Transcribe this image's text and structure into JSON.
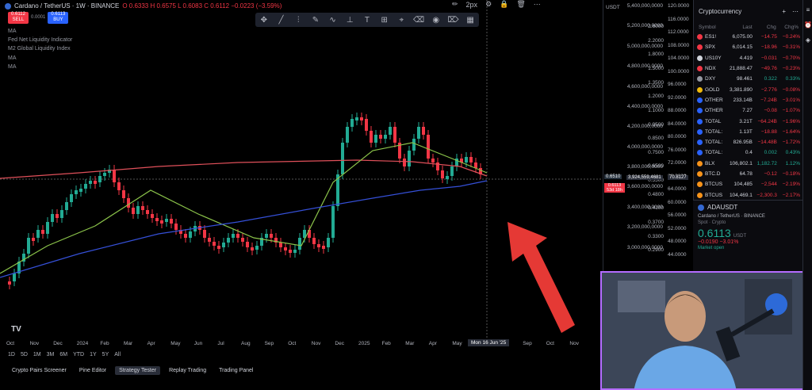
{
  "header": {
    "symbol_title": "Cardano / TetherUS · 1W · BINANCE",
    "ohlc": "O 0.6333  H 0.6575  L 0.6083  C 0.6112  −0.0223 (−3.59%)",
    "sell_price": "0.6112",
    "sell_label": "SELL",
    "spread": "0.0001",
    "buy_price": "0.6113",
    "buy_label": "BUY"
  },
  "indicators": [
    {
      "label": "MA"
    },
    {
      "label": "Fed Net Liquidity Indicator"
    },
    {
      "label": "M2 Global Liquidity Index"
    },
    {
      "label": "MA"
    },
    {
      "label": "MA"
    },
    {
      "label": "MA"
    }
  ],
  "draw_toolbar": {
    "icons": [
      "cross-icon",
      "trend-line-icon",
      "fib-icon",
      "brush-icon",
      "curve-icon",
      "ruler-icon",
      "text-icon",
      "measure-icon",
      "eraser-icon",
      "lock-icon",
      "eye-icon",
      "trash-icon",
      "layout-icon"
    ]
  },
  "top_tools": {
    "width_label": "2px"
  },
  "price_axis_left": {
    "currency": "USDT",
    "labels": [
      "2.6000",
      "2.2000",
      "1.8000",
      "1.5000",
      "1.3500",
      "1.2000",
      "1.1000",
      "0.9500",
      "0.8500",
      "0.7500",
      "0.6500",
      "0.5500",
      "0.4800",
      "0.4100",
      "0.3700",
      "0.3300",
      "0.2900"
    ],
    "current_top": "0.6510",
    "current_a": "0.6113",
    "current_b": "53d 18h"
  },
  "price_axis_mid": {
    "labels": [
      "5,400,000,0000",
      "5,200,000,0000",
      "5,000,000,0000",
      "4,800,000,0000",
      "4,600,000,0000",
      "4,400,000,0000",
      "4,200,000,0000",
      "4,000,000,0000",
      "3,800,000,0000",
      "3,600,000,0000",
      "3,400,000,0000",
      "3,200,000,0000",
      "3,000,000,0000"
    ],
    "highlight": "3,924,559,4681"
  },
  "price_axis_right": {
    "labels": [
      "120.0000",
      "116.0000",
      "112.0000",
      "108.0000",
      "104.0000",
      "100.0000",
      "96.0000",
      "92.0000",
      "88.0000",
      "84.0000",
      "80.0000",
      "76.0000",
      "72.0000",
      "68.0000",
      "64.0000",
      "60.0000",
      "56.0000",
      "52.0000",
      "48.0000",
      "44.0000"
    ],
    "highlight": "70.8127"
  },
  "time_axis": {
    "labels": [
      "Oct",
      "Nov",
      "Dec",
      "2024",
      "Feb",
      "Mar",
      "Apr",
      "May",
      "Jun",
      "Jul",
      "Aug",
      "Sep",
      "Oct",
      "Nov",
      "Dec",
      "2025",
      "Feb",
      "Mar",
      "Apr",
      "May",
      "Jul",
      "Aug",
      "Sep",
      "Oct",
      "Nov"
    ],
    "crosshair_date": "Mon 16 Jun '25"
  },
  "range_bar": [
    "1D",
    "5D",
    "1M",
    "3M",
    "6M",
    "YTD",
    "1Y",
    "5Y",
    "All"
  ],
  "bottom_tabs": [
    {
      "label": "Crypto Pairs Screener",
      "active": false
    },
    {
      "label": "Pine Editor",
      "active": false
    },
    {
      "label": "Strategy Tester",
      "active": true
    },
    {
      "label": "Replay Trading",
      "active": false
    },
    {
      "label": "Trading Panel",
      "active": false
    }
  ],
  "watchlist": {
    "title": "Cryptocurrency",
    "columns": [
      "Symbol",
      "Last",
      "Chg",
      "Chg%"
    ],
    "rows": [
      {
        "symbol": "ES1!",
        "last": "6,075.00",
        "chg": "−14.75",
        "chgp": "−0.24%",
        "dir": "neg",
        "icon": "#f23645"
      },
      {
        "symbol": "SPX",
        "last": "6,014.15",
        "chg": "−18.96",
        "chgp": "−0.31%",
        "dir": "neg",
        "icon": "#f23645"
      },
      {
        "symbol": "US10Y",
        "last": "4.419",
        "chg": "−0.031",
        "chgp": "−0.70%",
        "dir": "neg",
        "icon": "#d1d4dc"
      },
      {
        "symbol": "NDX",
        "last": "21,888.47",
        "chg": "−49.76",
        "chgp": "−0.23%",
        "dir": "neg",
        "icon": "#f23645"
      },
      {
        "symbol": "DXY",
        "last": "98.461",
        "chg": "0.322",
        "chgp": "0.33%",
        "dir": "pos",
        "icon": "#9598a1"
      },
      {
        "symbol": "GOLD",
        "last": "3,381.890",
        "chg": "−2.776",
        "chgp": "−0.08%",
        "dir": "neg",
        "icon": "#f0b90b"
      },
      {
        "symbol": "OTHER",
        "last": "233.14B",
        "chg": "−7.24B",
        "chgp": "−3.01%",
        "dir": "neg",
        "icon": "#2962ff"
      },
      {
        "symbol": "OTHER",
        "last": "7.27",
        "chg": "−0.08",
        "chgp": "−1.07%",
        "dir": "neg",
        "icon": "#2962ff"
      },
      {
        "symbol": "TOTAL",
        "last": "3.21T",
        "chg": "−64.24B",
        "chgp": "−1.96%",
        "dir": "neg",
        "icon": "#2962ff"
      },
      {
        "symbol": "TOTAL:",
        "last": "1.13T",
        "chg": "−18.88",
        "chgp": "−1.64%",
        "dir": "neg",
        "icon": "#2962ff"
      },
      {
        "symbol": "TOTAL:",
        "last": "826.95B",
        "chg": "−14.48B",
        "chgp": "−1.72%",
        "dir": "neg",
        "icon": "#2962ff"
      },
      {
        "symbol": "TOTAL:",
        "last": "0.4",
        "chg": "0.002",
        "chgp": "0.43%",
        "dir": "pos",
        "icon": "#2962ff"
      },
      {
        "symbol": "BLX",
        "last": "106,802.1",
        "chg": "1,182.72",
        "chgp": "1.12%",
        "dir": "pos",
        "icon": "#f7931a"
      },
      {
        "symbol": "BTC.D",
        "last": "64.78",
        "chg": "−0.12",
        "chgp": "−0.18%",
        "dir": "neg",
        "icon": "#f7931a"
      },
      {
        "symbol": "BTCUS",
        "last": "104,485",
        "chg": "−2,544",
        "chgp": "−2.19%",
        "dir": "neg",
        "icon": "#f7931a"
      },
      {
        "symbol": "BTCUS",
        "last": "104,469.1",
        "chg": "−2,300.3",
        "chgp": "−2.17%",
        "dir": "neg",
        "icon": "#f7931a"
      }
    ]
  },
  "detail": {
    "symbol": "ADAUSDT",
    "name": "Cardano / TetherUS · BINANCE",
    "sub": "Spot · Crypto",
    "price": "0.6113",
    "unit": "USDT",
    "change": "−0.0190  −3.01%",
    "status": "Market open"
  },
  "colors": {
    "up": "#22ab94",
    "down": "#f23645",
    "ma_red": "#e0505a",
    "ma_green": "#8bc34a",
    "ma_blue": "#3550d8",
    "arrow": "#e53935"
  }
}
